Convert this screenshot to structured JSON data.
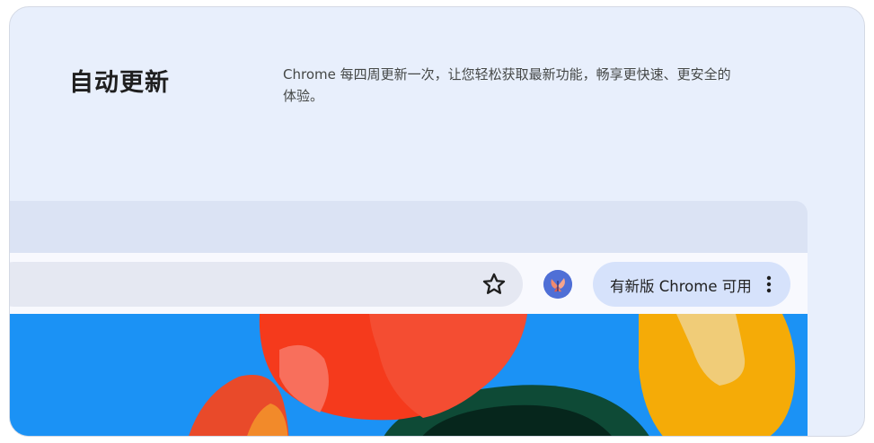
{
  "section": {
    "title": "自动更新",
    "description": "Chrome 每四周更新一次，让您轻松获取最新功能，畅享更快速、更安全的体验。"
  },
  "browser": {
    "toolbar": {
      "bookmark_icon": "star-outline-icon",
      "profile_icon": "profile-avatar-butterfly",
      "update_button_label": "有新版 Chrome 可用",
      "menu_icon": "vertical-dots-icon"
    },
    "content": {
      "illustration": "colorful-flowers-illustration"
    }
  },
  "colors": {
    "card_background": "#e8effc",
    "content_background": "#1b92f5",
    "update_pill": "#d6e2fb",
    "avatar": "#4f6fd6"
  }
}
